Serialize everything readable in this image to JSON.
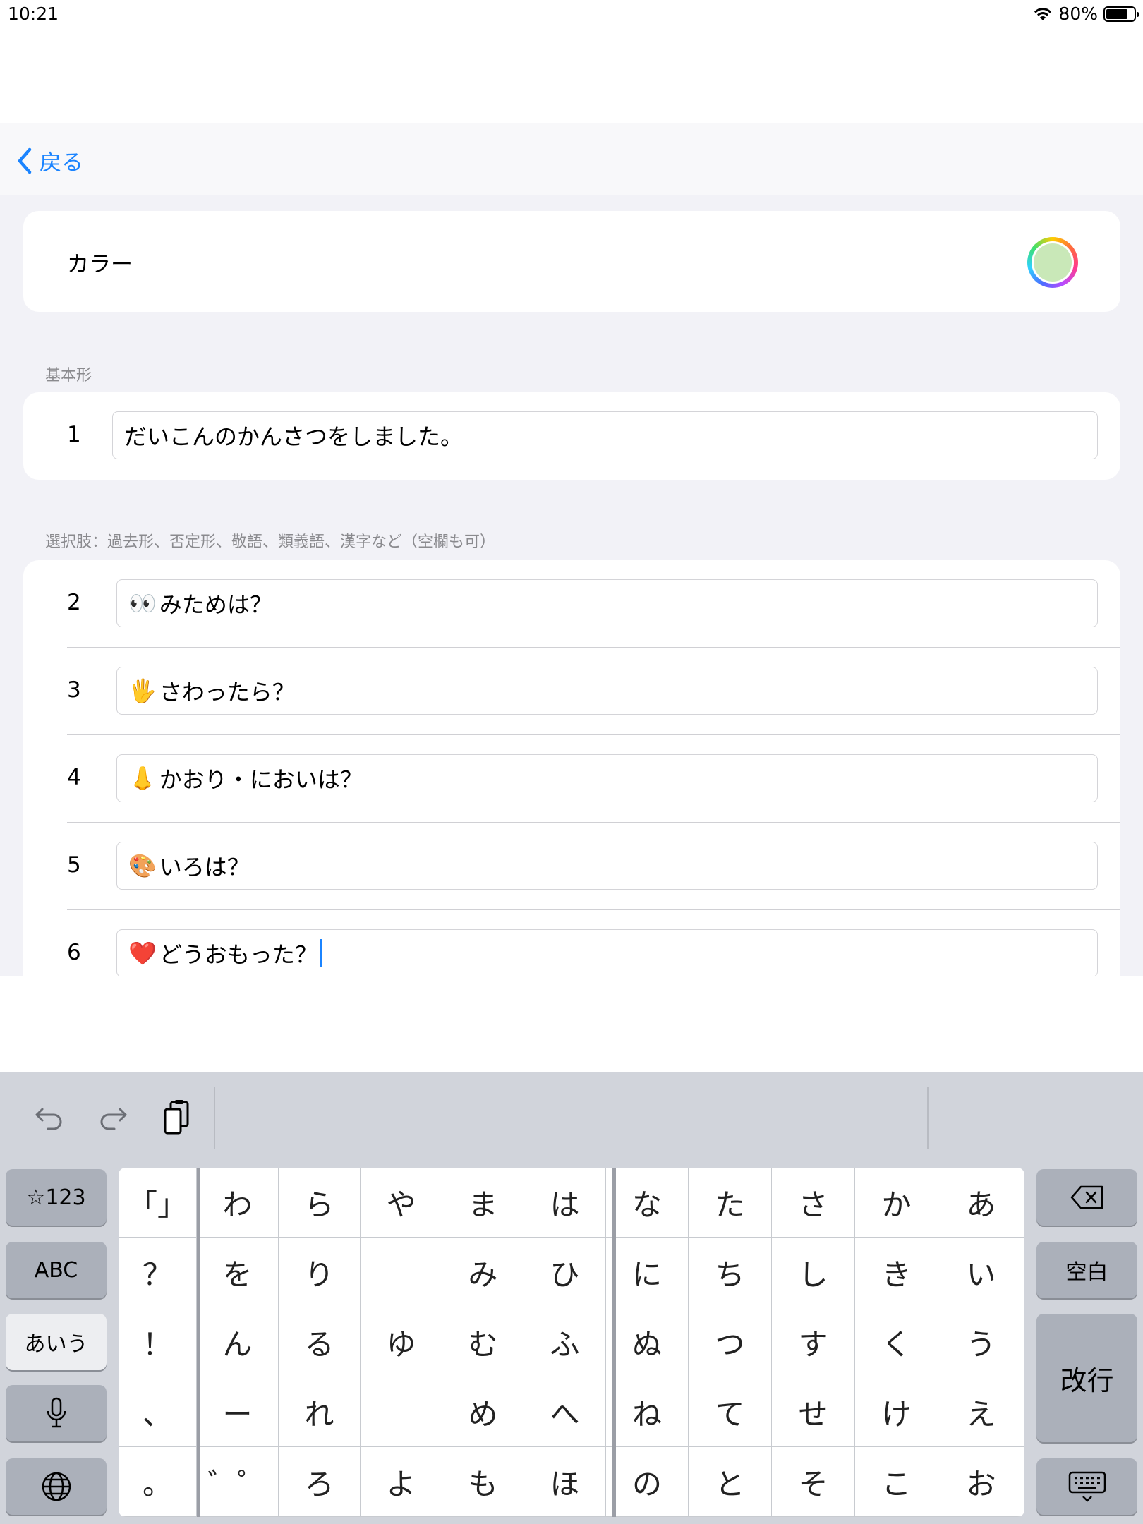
{
  "status_bar": {
    "time": "10:21",
    "battery": "80%"
  },
  "nav": {
    "back_label": "戻る"
  },
  "color_row": {
    "label": "カラー",
    "selected_color": "#c9e8b8"
  },
  "base_section": {
    "header": "基本形",
    "row": {
      "number": "1",
      "value": "だいこんのかんさつをしました。"
    }
  },
  "options_section": {
    "header": "選択肢：過去形、否定形、敬語、類義語、漢字など（空欄も可）",
    "rows": [
      {
        "number": "2",
        "emoji": "👀",
        "text": "みためは？"
      },
      {
        "number": "3",
        "emoji": "🖐",
        "text": "さわったら？"
      },
      {
        "number": "4",
        "emoji": "👃",
        "text": "かおり・においは？"
      },
      {
        "number": "5",
        "emoji": "🎨",
        "text": "いろは？"
      },
      {
        "number": "6",
        "emoji": "❤️",
        "text": "どうおもった？"
      }
    ]
  },
  "keyboard": {
    "toolbar": {
      "undo": "↶",
      "redo": "↷",
      "paste": "📋"
    },
    "left_keys": [
      "☆123",
      "ABC",
      "あいう",
      "🎤",
      "🌐"
    ],
    "right_keys": [
      "⌫",
      "空白",
      "改行",
      "⌨"
    ],
    "kana_rows": [
      [
        "「」",
        "わ",
        "ら",
        "や",
        "ま",
        "は",
        "な",
        "た",
        "さ",
        "か",
        "あ"
      ],
      [
        "？",
        "を",
        "り",
        "",
        "み",
        "ひ",
        "に",
        "ち",
        "し",
        "き",
        "い"
      ],
      [
        "！",
        "ん",
        "る",
        "ゆ",
        "む",
        "ふ",
        "ぬ",
        "つ",
        "す",
        "く",
        "う"
      ],
      [
        "、",
        "ー",
        "れ",
        "",
        "め",
        "へ",
        "ね",
        "て",
        "せ",
        "け",
        "え"
      ],
      [
        "。",
        "゛゜",
        "ろ",
        "よ",
        "も",
        "ほ",
        "の",
        "と",
        "そ",
        "こ",
        "お"
      ]
    ]
  }
}
